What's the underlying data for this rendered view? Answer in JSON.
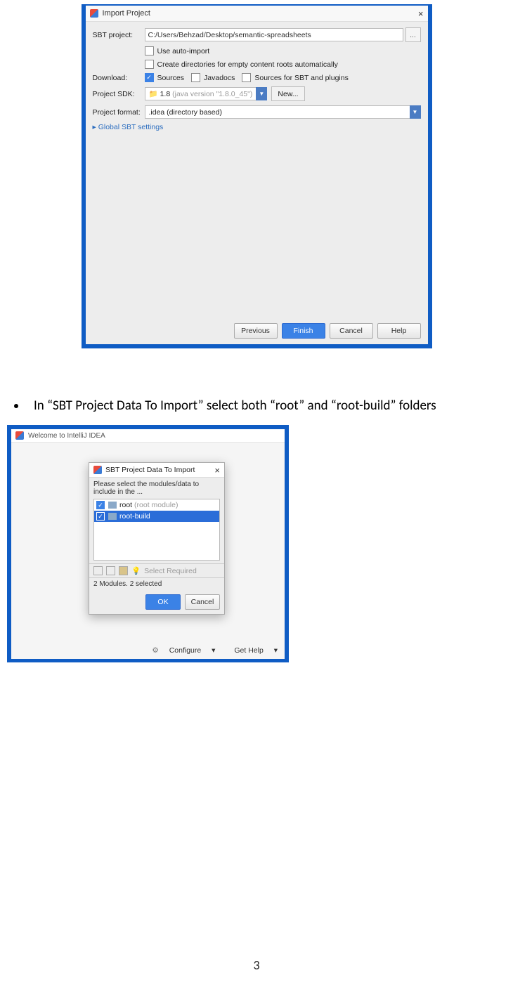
{
  "shot1": {
    "title": "Import Project",
    "sbt_label": "SBT project:",
    "sbt_path": "C:/Users/Behzad/Desktop/semantic-spreadsheets",
    "auto_import": "Use auto-import",
    "create_dirs": "Create directories for empty content roots automatically",
    "download_label": "Download:",
    "download_sources": "Sources",
    "download_javadocs": "Javadocs",
    "download_sbt_sources": "Sources for SBT and plugins",
    "sdk_label": "Project SDK:",
    "sdk_value": "1.8",
    "sdk_detail": "(java version \"1.8.0_45\")",
    "new_btn": "New...",
    "format_label": "Project format:",
    "format_value": ".idea (directory based)",
    "global_link": "Global SBT settings",
    "prev": "Previous",
    "finish": "Finish",
    "cancel": "Cancel",
    "help": "Help"
  },
  "bullet": "In “SBT Project Data To Import” select both “root” and “root-build” folders",
  "shot2": {
    "welcome_title": "Welcome to IntelliJ IDEA",
    "dlg_title": "SBT Project Data To Import",
    "prompt": "Please select the modules/data to include in the ...",
    "row1": "root",
    "row1_hint": "(root module)",
    "row2": "root-build",
    "select_required": "Select Required",
    "status": "2 Modules. 2 selected",
    "ok": "OK",
    "cancel": "Cancel",
    "configure": "Configure",
    "get_help": "Get Help"
  },
  "page_number": "3"
}
